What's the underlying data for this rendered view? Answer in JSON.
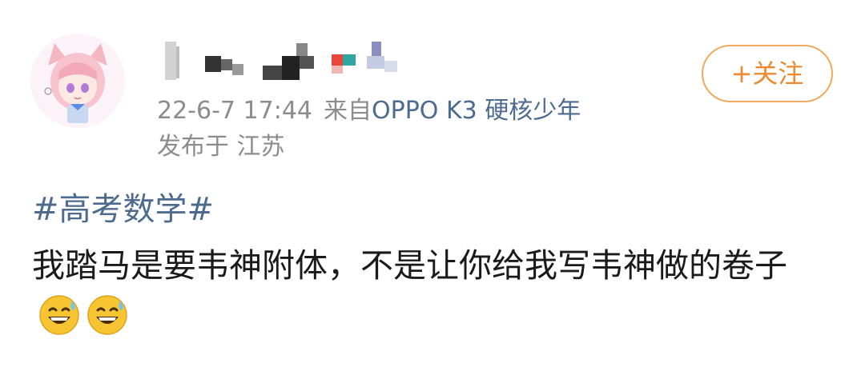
{
  "post": {
    "author": {
      "name": "",
      "avatar": "anime-girl-avatar"
    },
    "timestamp": "22-6-7 17:44",
    "source_prefix": "来自",
    "device": "OPPO K3 硬核少年",
    "location": "发布于 江苏",
    "follow_label": "+关注",
    "hashtag": "#高考数学#",
    "text": "我踏马是要韦神附体，不是让你给我写韦神做的卷子",
    "emojis": [
      "sweat-smile-emoji",
      "sweat-smile-emoji"
    ]
  },
  "colors": {
    "link": "#4d6b8f",
    "meta": "#8c8c8c",
    "follow": "#ed8a2d",
    "text": "#1a1a1a"
  }
}
